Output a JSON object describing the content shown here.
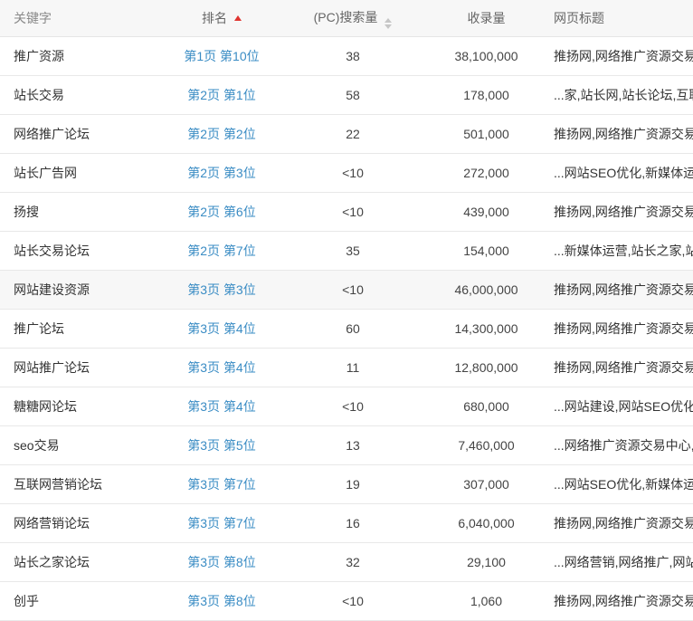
{
  "header": {
    "keyword": "关键字",
    "rank": "排名",
    "pc_volume": "(PC)搜索量",
    "indexed": "收录量",
    "title": "网页标题"
  },
  "rows": [
    {
      "keyword": "推广资源",
      "rank_page": "第1页",
      "rank_pos": "第10位",
      "pc": "38",
      "indexed": "38,100,000",
      "title": "推扬网,网络推广资源交易"
    },
    {
      "keyword": "站长交易",
      "rank_page": "第2页",
      "rank_pos": "第1位",
      "pc": "58",
      "indexed": "178,000",
      "title": "...家,站长网,站长论坛,互联"
    },
    {
      "keyword": "网络推广论坛",
      "rank_page": "第2页",
      "rank_pos": "第2位",
      "pc": "22",
      "indexed": "501,000",
      "title": "推扬网,网络推广资源交易"
    },
    {
      "keyword": "站长广告网",
      "rank_page": "第2页",
      "rank_pos": "第3位",
      "pc": "<10",
      "indexed": "272,000",
      "title": "...网站SEO优化,新媒体运营"
    },
    {
      "keyword": "扬搜",
      "rank_page": "第2页",
      "rank_pos": "第6位",
      "pc": "<10",
      "indexed": "439,000",
      "title": "推扬网,网络推广资源交易"
    },
    {
      "keyword": "站长交易论坛",
      "rank_page": "第2页",
      "rank_pos": "第7位",
      "pc": "35",
      "indexed": "154,000",
      "title": "...新媒体运营,站长之家,站长"
    },
    {
      "keyword": "网站建设资源",
      "rank_page": "第3页",
      "rank_pos": "第3位",
      "pc": "<10",
      "indexed": "46,000,000",
      "title": "推扬网,网络推广资源交易"
    },
    {
      "keyword": "推广论坛",
      "rank_page": "第3页",
      "rank_pos": "第4位",
      "pc": "60",
      "indexed": "14,300,000",
      "title": "推扬网,网络推广资源交易"
    },
    {
      "keyword": "网站推广论坛",
      "rank_page": "第3页",
      "rank_pos": "第4位",
      "pc": "11",
      "indexed": "12,800,000",
      "title": "推扬网,网络推广资源交易"
    },
    {
      "keyword": "糖糖网论坛",
      "rank_page": "第3页",
      "rank_pos": "第4位",
      "pc": "<10",
      "indexed": "680,000",
      "title": "...网站建设,网站SEO优化,"
    },
    {
      "keyword": "seo交易",
      "rank_page": "第3页",
      "rank_pos": "第5位",
      "pc": "13",
      "indexed": "7,460,000",
      "title": "...网络推广资源交易中心,"
    },
    {
      "keyword": "互联网营销论坛",
      "rank_page": "第3页",
      "rank_pos": "第7位",
      "pc": "19",
      "indexed": "307,000",
      "title": "...网站SEO优化,新媒体运营"
    },
    {
      "keyword": "网络营销论坛",
      "rank_page": "第3页",
      "rank_pos": "第7位",
      "pc": "16",
      "indexed": "6,040,000",
      "title": "推扬网,网络推广资源交易"
    },
    {
      "keyword": "站长之家论坛",
      "rank_page": "第3页",
      "rank_pos": "第8位",
      "pc": "32",
      "indexed": "29,100",
      "title": "...网络营销,网络推广,网站"
    },
    {
      "keyword": "创乎",
      "rank_page": "第3页",
      "rank_pos": "第8位",
      "pc": "<10",
      "indexed": "1,060",
      "title": "推扬网,网络推广资源交易"
    }
  ],
  "highlighted_row_index": 6,
  "colors": {
    "link": "#3a8cc4",
    "sort_active": "#e0342f",
    "sort_inactive": "#c6c6c6",
    "header_bg": "#f7f7f7",
    "row_border": "#e8e8e8"
  },
  "icons": {
    "rank_sort": "sort-ascending-icon",
    "pc_sort": "sort-both-icon"
  }
}
